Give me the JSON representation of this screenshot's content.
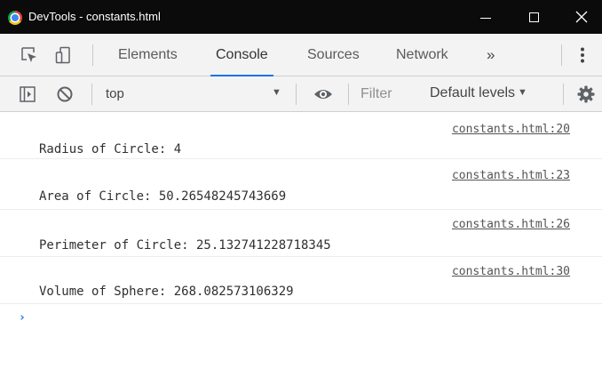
{
  "window": {
    "title": "DevTools - constants.html"
  },
  "tabs": [
    {
      "label": "Elements",
      "active": false
    },
    {
      "label": "Console",
      "active": true
    },
    {
      "label": "Sources",
      "active": false
    },
    {
      "label": "Network",
      "active": false
    }
  ],
  "overflow_tabs_label": "»",
  "console_toolbar": {
    "context": "top",
    "filter_placeholder": "Filter",
    "levels_label": "Default levels"
  },
  "messages": [
    {
      "source": "constants.html:20",
      "text": "Radius of Circle: 4"
    },
    {
      "source": "constants.html:23",
      "text": "Area of Circle: 50.26548245743669"
    },
    {
      "source": "constants.html:26",
      "text": "Perimeter of Circle: 25.132741228718345"
    },
    {
      "source": "constants.html:30",
      "text": "Volume of Sphere: 268.082573106329"
    }
  ],
  "prompt_symbol": "›",
  "colors": {
    "titlebar_bg": "#0b0b0b",
    "toolbar_bg": "#f3f3f3",
    "active_tab_underline": "#1a73e8",
    "prompt": "#1a73e8"
  },
  "icons": [
    "browser-app-icon",
    "minimize-icon",
    "maximize-icon",
    "close-icon",
    "inspect-element-icon",
    "device-toolbar-icon",
    "more-tabs-icon",
    "kebab-menu-icon",
    "sidebar-toggle-icon",
    "clear-console-icon",
    "chevron-down-icon",
    "eye-icon",
    "settings-gear-icon",
    "prompt-chevron-icon"
  ]
}
